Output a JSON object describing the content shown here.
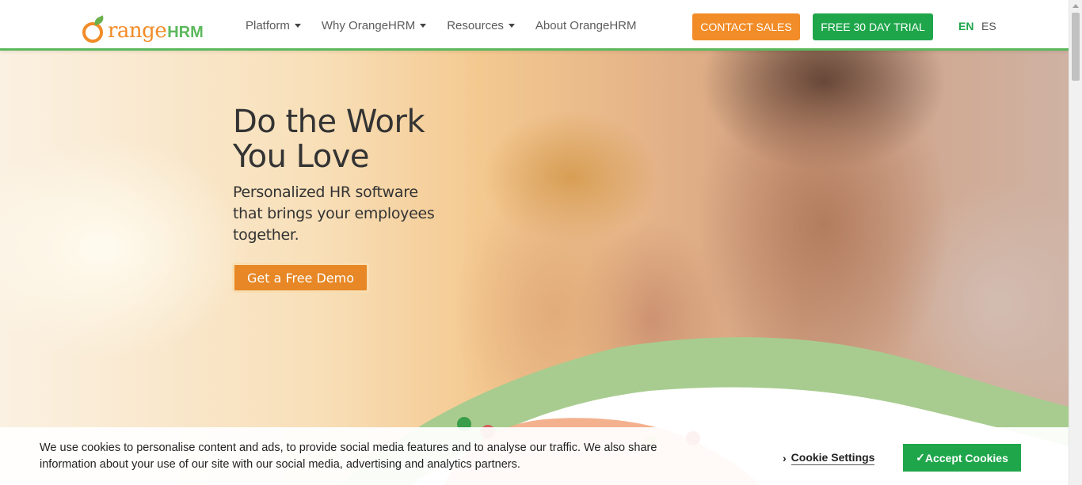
{
  "brand": {
    "logo_main": "range",
    "logo_suffix": "HRM"
  },
  "nav": {
    "items": [
      {
        "label": "Platform",
        "dropdown": true
      },
      {
        "label": "Why OrangeHRM",
        "dropdown": true
      },
      {
        "label": "Resources",
        "dropdown": true
      },
      {
        "label": "About OrangeHRM",
        "dropdown": false
      }
    ],
    "contact_sales": "CONTACT SALES",
    "free_trial": "FREE 30 DAY TRIAL",
    "lang_en": "EN",
    "lang_es": "ES"
  },
  "hero": {
    "title": "Do the Work You Love",
    "subtitle": "Personalized HR software that brings your employees together.",
    "cta": "Get a Free Demo"
  },
  "cookie": {
    "text": "We use cookies to personalise content and ads, to provide social media features and to analyse our traffic. We also share information about your use of our site with our social media, advertising and analytics partners.",
    "settings": "Cookie Settings",
    "settings_chevron": "›",
    "accept": "Accept Cookies",
    "accept_check": "✓"
  },
  "colors": {
    "brand_orange": "#f28c28",
    "brand_green": "#1fa64b",
    "wave_green": "#a8cc8f"
  }
}
